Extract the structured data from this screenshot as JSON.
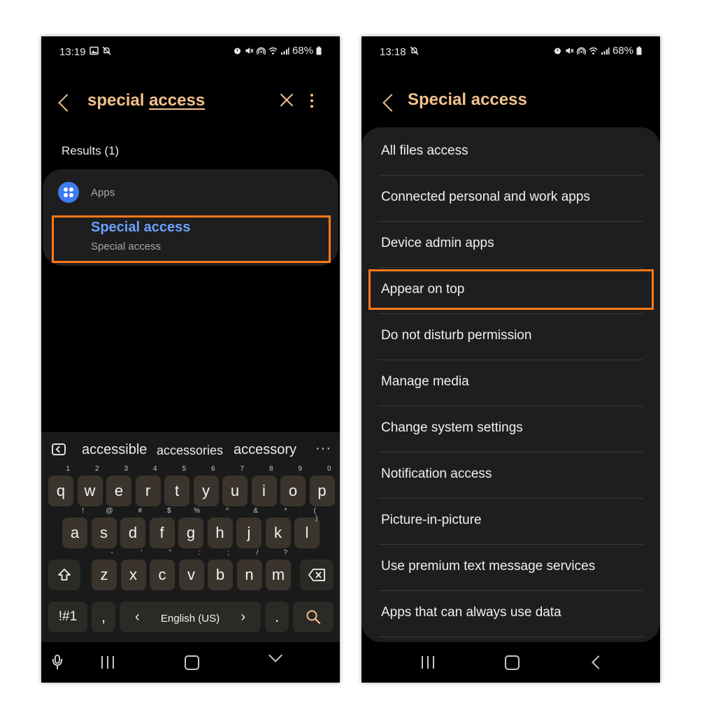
{
  "left_phone": {
    "status": {
      "time": "13:19",
      "left_icons": [
        "image-icon",
        "bell-off-icon"
      ],
      "right_icons": [
        "alarm-icon",
        "mute-icon",
        "hotspot-icon",
        "wifi-icon",
        "signal-icon"
      ],
      "battery": "68%"
    },
    "search": {
      "query_part1": "special",
      "query_part2": "access"
    },
    "results_label": "Results (1)",
    "result_group": {
      "category": "Apps",
      "title": "Special access",
      "subtitle": "Special access"
    },
    "suggestions": [
      "accessible",
      "accessories",
      "accessory"
    ],
    "suggest_more": "···",
    "keyboard": {
      "row1": [
        {
          "k": "q",
          "h": "1"
        },
        {
          "k": "w",
          "h": "2"
        },
        {
          "k": "e",
          "h": "3"
        },
        {
          "k": "r",
          "h": "4"
        },
        {
          "k": "t",
          "h": "5"
        },
        {
          "k": "y",
          "h": "6"
        },
        {
          "k": "u",
          "h": "7"
        },
        {
          "k": "i",
          "h": "8"
        },
        {
          "k": "o",
          "h": "9"
        },
        {
          "k": "p",
          "h": "0"
        }
      ],
      "row2": [
        {
          "k": "a",
          "h": "!"
        },
        {
          "k": "s",
          "h": "@"
        },
        {
          "k": "d",
          "h": "#"
        },
        {
          "k": "f",
          "h": "$"
        },
        {
          "k": "g",
          "h": "%"
        },
        {
          "k": "h",
          "h": "^"
        },
        {
          "k": "j",
          "h": "&"
        },
        {
          "k": "k",
          "h": "*"
        },
        {
          "k": "l",
          "h": "("
        }
      ],
      "row2_extra_hint": ")",
      "row3": [
        {
          "k": "z",
          "h": "-"
        },
        {
          "k": "x",
          "h": "'"
        },
        {
          "k": "c",
          "h": "\""
        },
        {
          "k": "v",
          "h": ":"
        },
        {
          "k": "b",
          "h": ";"
        },
        {
          "k": "n",
          "h": "/"
        },
        {
          "k": "m",
          "h": "?"
        }
      ],
      "symbols": "!#1",
      "comma": ",",
      "language": "English (US)",
      "lang_left": "‹",
      "lang_right": "›",
      "period": "."
    }
  },
  "right_phone": {
    "status": {
      "time": "13:18",
      "left_icons": [
        "bell-off-icon"
      ],
      "right_icons": [
        "alarm-icon",
        "mute-icon",
        "hotspot-icon",
        "wifi-icon",
        "signal-icon"
      ],
      "battery": "68%"
    },
    "title": "Special access",
    "items": [
      "All files access",
      "Connected personal and work apps",
      "Device admin apps",
      "Appear on top",
      "Do not disturb permission",
      "Manage media",
      "Change system settings",
      "Notification access",
      "Picture-in-picture",
      "Use premium text message services",
      "Apps that can always use data"
    ]
  },
  "colors": {
    "accent": "#f2c18c",
    "highlight": "#ff7a1a",
    "link_blue": "#6ba2ff",
    "card": "#1e1e1e"
  }
}
